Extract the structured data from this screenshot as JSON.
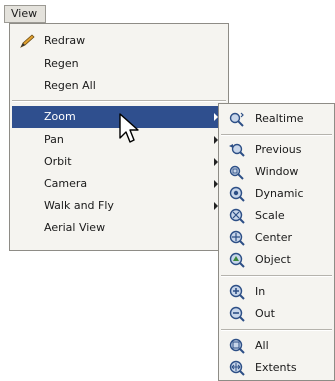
{
  "menubar": {
    "view_label": "View"
  },
  "view_menu": {
    "items": [
      {
        "label": "Redraw",
        "icon": "redraw-pencil-icon"
      },
      {
        "label": "Regen"
      },
      {
        "label": "Regen All"
      },
      {
        "label": "Zoom",
        "submenu": true,
        "highlighted": true
      },
      {
        "label": "Pan",
        "submenu": true
      },
      {
        "label": "Orbit",
        "submenu": true
      },
      {
        "label": "Camera",
        "submenu": true
      },
      {
        "label": "Walk and Fly",
        "submenu": true
      },
      {
        "label": "Aerial View"
      }
    ]
  },
  "zoom_menu": {
    "items": [
      {
        "label": "Realtime",
        "icon": "zoom-realtime-icon"
      },
      {
        "label": "Previous",
        "icon": "zoom-previous-icon"
      },
      {
        "label": "Window",
        "icon": "zoom-window-icon"
      },
      {
        "label": "Dynamic",
        "icon": "zoom-dynamic-icon"
      },
      {
        "label": "Scale",
        "icon": "zoom-scale-icon"
      },
      {
        "label": "Center",
        "icon": "zoom-center-icon"
      },
      {
        "label": "Object",
        "icon": "zoom-object-icon"
      },
      {
        "label": "In",
        "icon": "zoom-in-icon"
      },
      {
        "label": "Out",
        "icon": "zoom-out-icon"
      },
      {
        "label": "All",
        "icon": "zoom-all-icon"
      },
      {
        "label": "Extents",
        "icon": "zoom-extents-icon"
      }
    ]
  },
  "colors": {
    "highlight": "#2f4f8e",
    "menu_bg": "#f5f4f0"
  }
}
